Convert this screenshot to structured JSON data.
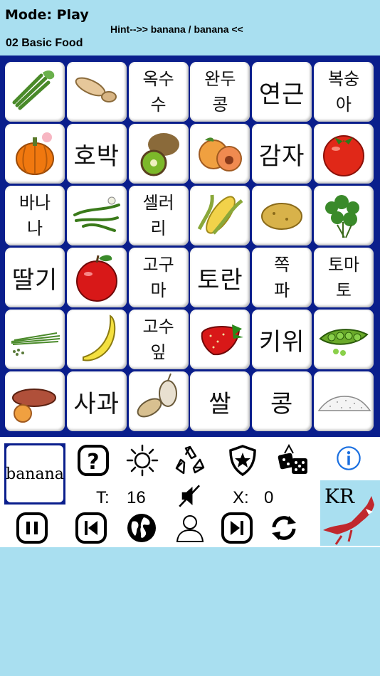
{
  "header": {
    "mode": "Mode:  Play",
    "hint": "Hint-->> banana / banana <<",
    "deck": "02 Basic Food"
  },
  "tiles": [
    {
      "kind": "img",
      "icon": "celery-icon"
    },
    {
      "kind": "img",
      "icon": "taro-root-icon"
    },
    {
      "kind": "sm",
      "text": "옥수\n수"
    },
    {
      "kind": "sm",
      "text": "완두\n콩"
    },
    {
      "kind": "lg",
      "text": "연근"
    },
    {
      "kind": "sm",
      "text": "복숭\n아"
    },
    {
      "kind": "img",
      "icon": "pumpkin-icon"
    },
    {
      "kind": "lg",
      "text": "호박"
    },
    {
      "kind": "img",
      "icon": "kiwi-icon"
    },
    {
      "kind": "img",
      "icon": "peach-icon"
    },
    {
      "kind": "lg",
      "text": "감자"
    },
    {
      "kind": "img",
      "icon": "tomato-icon"
    },
    {
      "kind": "sm",
      "text": "바나\n나"
    },
    {
      "kind": "img",
      "icon": "green-beans-icon"
    },
    {
      "kind": "sm",
      "text": "셀러\n리"
    },
    {
      "kind": "img",
      "icon": "corn-icon"
    },
    {
      "kind": "img",
      "icon": "potato-icon"
    },
    {
      "kind": "img",
      "icon": "cilantro-icon"
    },
    {
      "kind": "lg",
      "text": "딸기"
    },
    {
      "kind": "img",
      "icon": "apple-icon"
    },
    {
      "kind": "sm",
      "text": "고구\n마"
    },
    {
      "kind": "lg",
      "text": "토란"
    },
    {
      "kind": "sm",
      "text": "쪽\n파"
    },
    {
      "kind": "sm",
      "text": "토마\n토"
    },
    {
      "kind": "img",
      "icon": "chives-icon"
    },
    {
      "kind": "img",
      "icon": "banana-icon"
    },
    {
      "kind": "sm",
      "text": "고수\n잎"
    },
    {
      "kind": "img",
      "icon": "strawberry-icon"
    },
    {
      "kind": "lg",
      "text": "키위"
    },
    {
      "kind": "img",
      "icon": "peas-icon"
    },
    {
      "kind": "img",
      "icon": "sweet-potato-icon"
    },
    {
      "kind": "lg",
      "text": "사과"
    },
    {
      "kind": "img",
      "icon": "lotus-root-icon"
    },
    {
      "kind": "lg",
      "text": "쌀"
    },
    {
      "kind": "lg",
      "text": "콩"
    },
    {
      "kind": "img",
      "icon": "rice-icon"
    }
  ],
  "controls": {
    "current_word": "banana",
    "timer_label": "T:",
    "timer_value": "16",
    "errors_label": "X:",
    "errors_value": "0",
    "language_badge": "KR",
    "icons": [
      "help-icon",
      "brightness-icon",
      "recycle-icon",
      "shield-star-icon",
      "dice-icon",
      "info-icon",
      "mute-icon",
      "pause-icon",
      "skip-back-icon",
      "globe-icon",
      "profile-icon",
      "skip-forward-icon",
      "refresh-icon"
    ]
  },
  "colors": {
    "background": "#a9dff0",
    "board": "#0a1e8c",
    "info_blue": "#1a6fe0"
  }
}
